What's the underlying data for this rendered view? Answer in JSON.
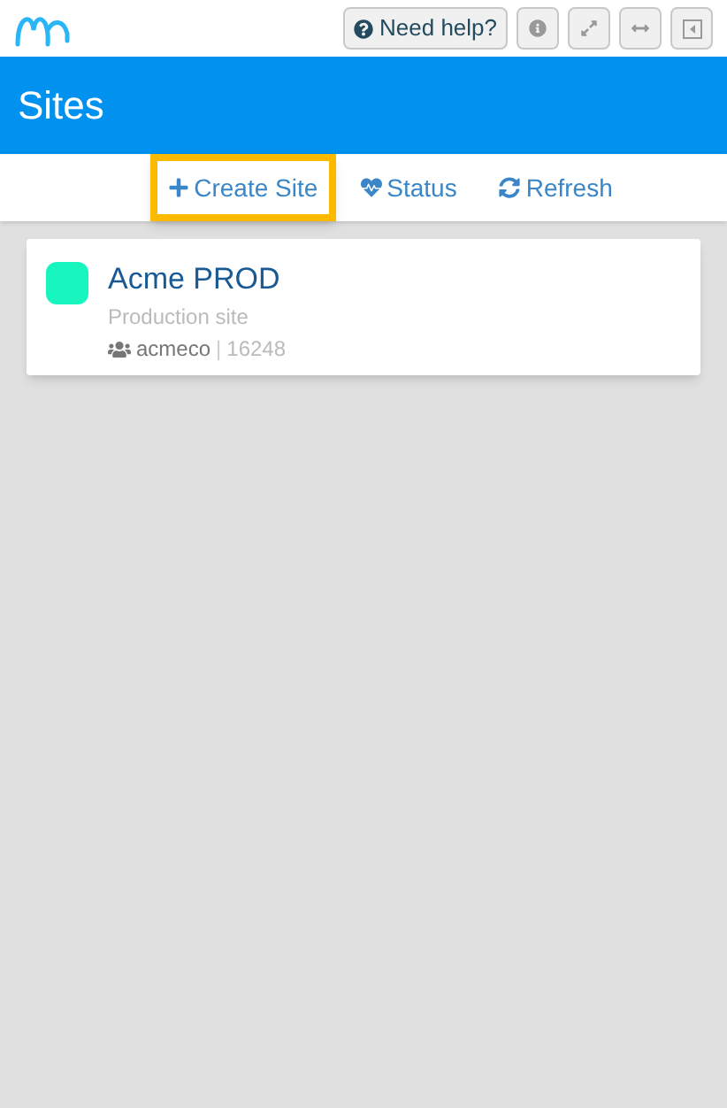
{
  "top_bar": {
    "help_button": "Need help?"
  },
  "header": {
    "title": "Sites"
  },
  "toolbar": [
    {
      "kind": "create",
      "label": "Create Site",
      "highlighted": true
    },
    {
      "kind": "status",
      "label": "Status",
      "highlighted": false
    },
    {
      "kind": "refresh",
      "label": "Refresh",
      "highlighted": false
    }
  ],
  "sites": [
    {
      "name": "Acme PROD",
      "description": "Production site",
      "color": "#19f5bf",
      "org": "acmeco",
      "separator": "|",
      "id": "16248"
    }
  ]
}
